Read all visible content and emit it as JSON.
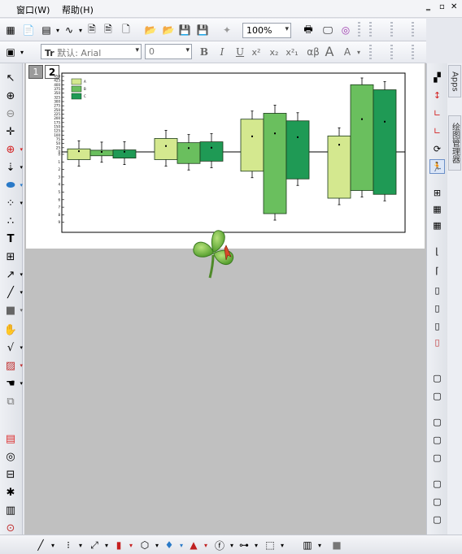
{
  "menu": {
    "window": "窗口(W)",
    "help": "帮助(H)"
  },
  "window_controls": {
    "minimize": "‗",
    "restore": "▫",
    "close": "✕"
  },
  "toolbar": {
    "zoom": "100%",
    "font_name": "默认: Arial",
    "font_size": "0",
    "bold": "B",
    "italic": "I",
    "underline": "U",
    "superscript": "x²",
    "subscript": "x₂",
    "supersub": "x²₁",
    "greek": "αβ",
    "grow_font": "A",
    "shrink_font": "A"
  },
  "layer_tabs": [
    "1",
    "2"
  ],
  "side_tabs": {
    "apps": "Apps",
    "graph_manager": "绘图管理器"
  },
  "colors": {
    "light": "#d4e88f",
    "mid": "#6abf5e",
    "dark": "#1f9a55",
    "clover": "#6bb83e"
  },
  "chart_data": {
    "type": "bar",
    "categories": [
      "",
      "",
      "",
      ""
    ],
    "series": [
      {
        "name": "A",
        "upper": [
          18,
          80,
          195,
          95
        ],
        "lower": [
          -10,
          -10,
          -25,
          -60
        ]
      },
      {
        "name": "B",
        "upper": [
          10,
          55,
          230,
          400
        ],
        "lower": [
          -5,
          -15,
          -80,
          -50
        ]
      },
      {
        "name": "C",
        "upper": [
          12,
          60,
          185,
          370
        ],
        "lower": [
          -8,
          -12,
          -35,
          -55
        ]
      }
    ],
    "ylim_upper": [
      0,
      450
    ],
    "yticks_upper": [
      "450",
      "425",
      "400",
      "375",
      "350",
      "325",
      "300",
      "275",
      "250",
      "225",
      "200",
      "175",
      "150",
      "125",
      "100",
      "75",
      "50",
      "25",
      "0"
    ],
    "yticks_lower": [
      "0",
      "1",
      "2",
      "3",
      "4",
      "5",
      "6",
      "7",
      "8",
      "9"
    ],
    "legend_labels": [
      "A",
      "B",
      "C"
    ]
  }
}
